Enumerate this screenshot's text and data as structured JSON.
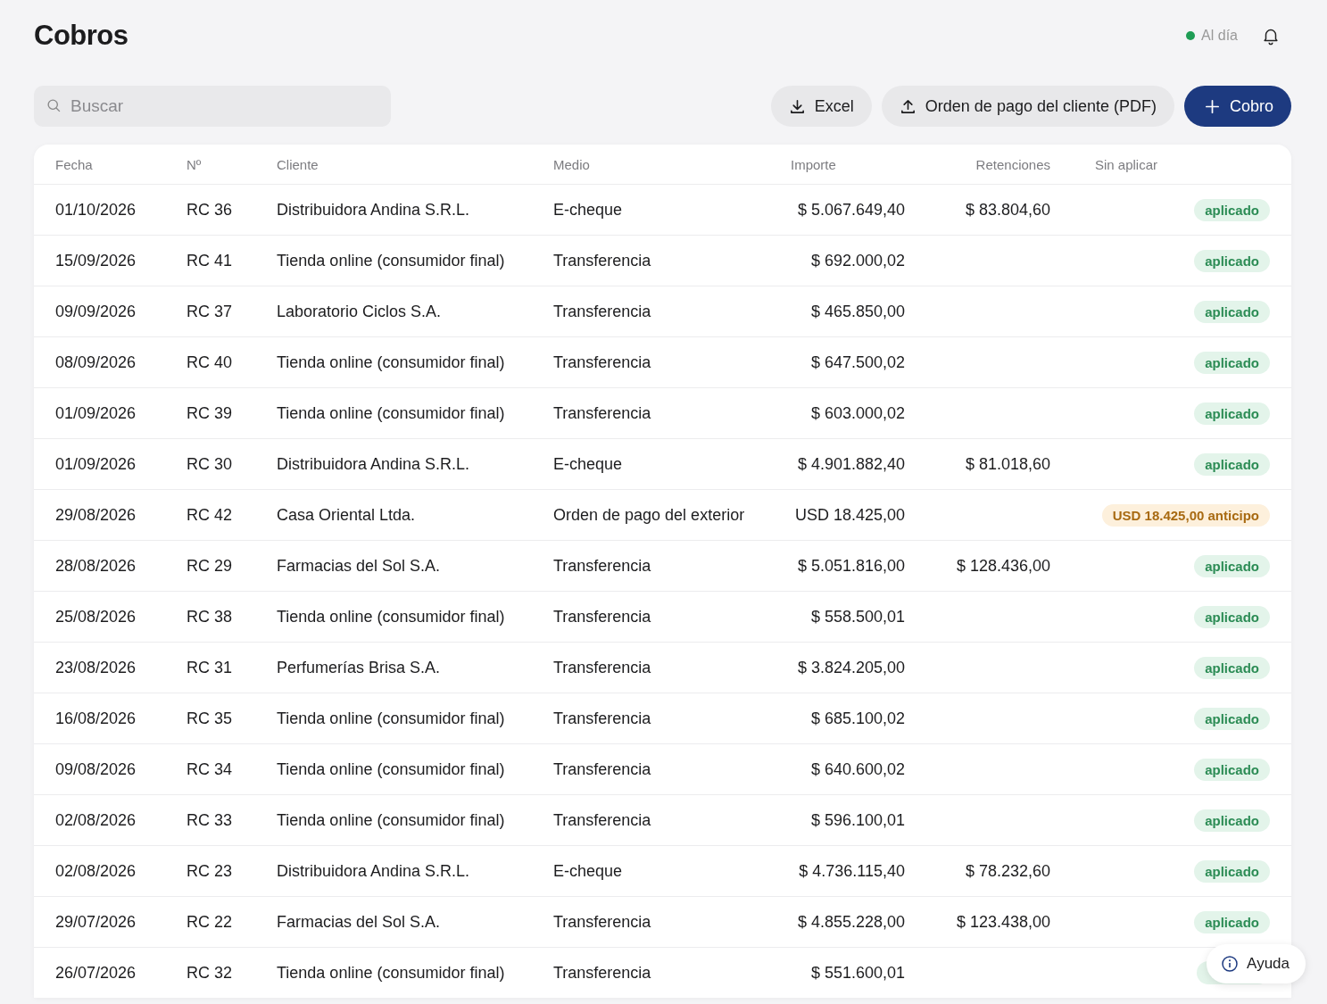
{
  "title": "Cobros",
  "sync_status": {
    "label": "Al día",
    "color": "#1f9d55"
  },
  "search": {
    "placeholder": "Buscar"
  },
  "actions": [
    {
      "kind": "download",
      "label": "Excel"
    },
    {
      "kind": "upload",
      "label": "Orden de pago del cliente (PDF)"
    },
    {
      "kind": "primary",
      "label": "Cobro"
    }
  ],
  "table": {
    "columns": [
      "Fecha",
      "Nº",
      "Cliente",
      "Medio",
      "Importe",
      "Retenciones",
      "Sin aplicar"
    ],
    "rows": [
      {
        "fecha": "01/10/2026",
        "numero": "RC 36",
        "cliente": "Distribuidora Andina S.R.L.",
        "medio": "E-cheque",
        "importe": "$ 5.067.649,40",
        "retenciones": "$ 83.804,60",
        "status": {
          "kind": "applied",
          "label": "aplicado"
        }
      },
      {
        "fecha": "15/09/2026",
        "numero": "RC 41",
        "cliente": "Tienda online (consumidor final)",
        "medio": "Transferencia",
        "importe": "$ 692.000,02",
        "status": {
          "kind": "applied",
          "label": "aplicado"
        }
      },
      {
        "fecha": "09/09/2026",
        "numero": "RC 37",
        "cliente": "Laboratorio Ciclos S.A.",
        "medio": "Transferencia",
        "importe": "$ 465.850,00",
        "status": {
          "kind": "applied",
          "label": "aplicado"
        }
      },
      {
        "fecha": "08/09/2026",
        "numero": "RC 40",
        "cliente": "Tienda online (consumidor final)",
        "medio": "Transferencia",
        "importe": "$ 647.500,02",
        "status": {
          "kind": "applied",
          "label": "aplicado"
        }
      },
      {
        "fecha": "01/09/2026",
        "numero": "RC 39",
        "cliente": "Tienda online (consumidor final)",
        "medio": "Transferencia",
        "importe": "$ 603.000,02",
        "status": {
          "kind": "applied",
          "label": "aplicado"
        }
      },
      {
        "fecha": "01/09/2026",
        "numero": "RC 30",
        "cliente": "Distribuidora Andina S.R.L.",
        "medio": "E-cheque",
        "importe": "$ 4.901.882,40",
        "retenciones": "$ 81.018,60",
        "status": {
          "kind": "applied",
          "label": "aplicado"
        }
      },
      {
        "fecha": "29/08/2026",
        "numero": "RC 42",
        "cliente": "Casa Oriental Ltda.",
        "medio": "Orden de pago del exterior",
        "importe": "USD 18.425,00",
        "status": {
          "kind": "advance",
          "label": "USD 18.425,00 anticipo"
        }
      },
      {
        "fecha": "28/08/2026",
        "numero": "RC 29",
        "cliente": "Farmacias del Sol S.A.",
        "medio": "Transferencia",
        "importe": "$ 5.051.816,00",
        "retenciones": "$ 128.436,00",
        "status": {
          "kind": "applied",
          "label": "aplicado"
        }
      },
      {
        "fecha": "25/08/2026",
        "numero": "RC 38",
        "cliente": "Tienda online (consumidor final)",
        "medio": "Transferencia",
        "importe": "$ 558.500,01",
        "status": {
          "kind": "applied",
          "label": "aplicado"
        }
      },
      {
        "fecha": "23/08/2026",
        "numero": "RC 31",
        "cliente": "Perfumerías Brisa S.A.",
        "medio": "Transferencia",
        "importe": "$ 3.824.205,00",
        "status": {
          "kind": "applied",
          "label": "aplicado"
        }
      },
      {
        "fecha": "16/08/2026",
        "numero": "RC 35",
        "cliente": "Tienda online (consumidor final)",
        "medio": "Transferencia",
        "importe": "$ 685.100,02",
        "status": {
          "kind": "applied",
          "label": "aplicado"
        }
      },
      {
        "fecha": "09/08/2026",
        "numero": "RC 34",
        "cliente": "Tienda online (consumidor final)",
        "medio": "Transferencia",
        "importe": "$ 640.600,02",
        "status": {
          "kind": "applied",
          "label": "aplicado"
        }
      },
      {
        "fecha": "02/08/2026",
        "numero": "RC 33",
        "cliente": "Tienda online (consumidor final)",
        "medio": "Transferencia",
        "importe": "$ 596.100,01",
        "status": {
          "kind": "applied",
          "label": "aplicado"
        }
      },
      {
        "fecha": "02/08/2026",
        "numero": "RC 23",
        "cliente": "Distribuidora Andina S.R.L.",
        "medio": "E-cheque",
        "importe": "$ 4.736.115,40",
        "retenciones": "$ 78.232,60",
        "status": {
          "kind": "applied",
          "label": "aplicado"
        }
      },
      {
        "fecha": "29/07/2026",
        "numero": "RC 22",
        "cliente": "Farmacias del Sol S.A.",
        "medio": "Transferencia",
        "importe": "$ 4.855.228,00",
        "retenciones": "$ 123.438,00",
        "status": {
          "kind": "applied",
          "label": "aplicado"
        }
      },
      {
        "fecha": "26/07/2026",
        "numero": "RC 32",
        "cliente": "Tienda online (consumidor final)",
        "medio": "Transferencia",
        "importe": "$ 551.600,01",
        "status": {
          "kind": "applied"
        }
      }
    ]
  },
  "help_button": {
    "label": "Ayuda"
  }
}
